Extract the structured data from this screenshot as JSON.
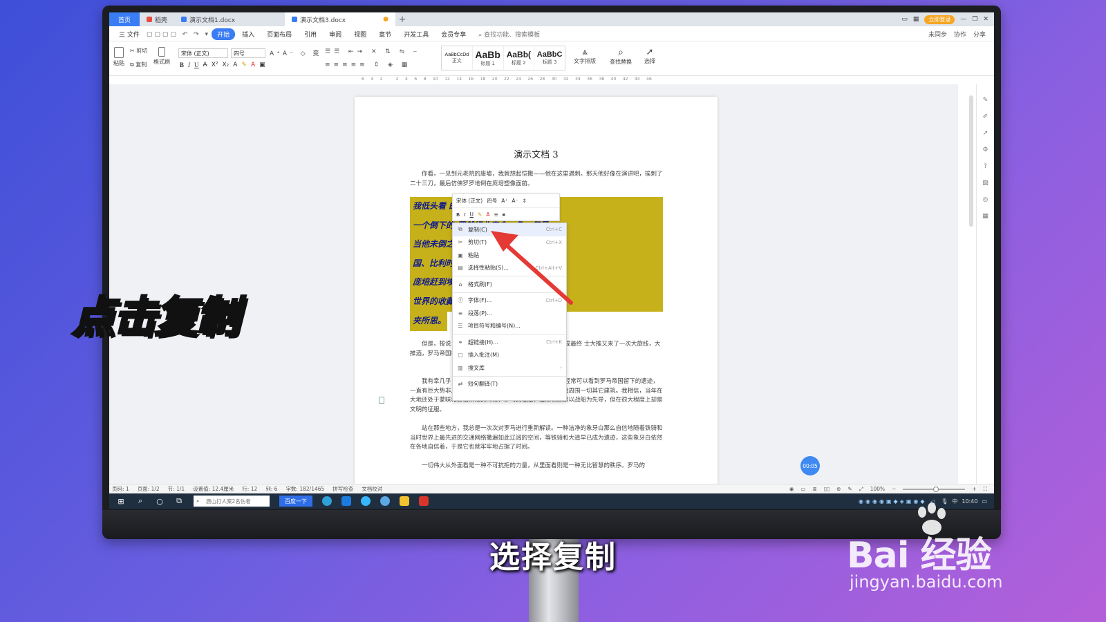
{
  "tabs": {
    "home": "首页",
    "items": [
      {
        "label": "稻壳",
        "color": "#e84c3d"
      },
      {
        "label": "演示文档1.docx",
        "color": "#3a7cf4"
      },
      {
        "label": "演示文档3.docx",
        "color": "#3a7cf4",
        "active": true
      }
    ],
    "add": "+",
    "login": "立即登录"
  },
  "menubar": {
    "file": "三 文件",
    "items": [
      "开始",
      "插入",
      "页面布局",
      "引用",
      "审阅",
      "视图",
      "章节",
      "开发工具",
      "会员专享"
    ],
    "active_index": 0,
    "search": "查找功能、搜索模板",
    "right": [
      "未同步",
      "协作",
      "分享"
    ]
  },
  "ribbon": {
    "paste": "粘贴",
    "cut": "剪切",
    "copy": "复制",
    "format_painter": "格式刷",
    "font_name": "宋体 (正文)",
    "font_size": "四号",
    "styles": [
      {
        "sample": "AaBbCcDd",
        "label": "正文"
      },
      {
        "sample": "AaBb",
        "label": "标题 1"
      },
      {
        "sample": "AaBb(",
        "label": "标题 2"
      },
      {
        "sample": "AaBbC",
        "label": "标题 3"
      }
    ],
    "text_layout": "文字排版",
    "find_replace": "查找替换",
    "select": "选择"
  },
  "ruler_ticks": [
    "6",
    "4",
    "2",
    "",
    "2",
    "4",
    "6",
    "8",
    "10",
    "12",
    "14",
    "16",
    "18",
    "20",
    "22",
    "24",
    "26",
    "28",
    "30",
    "32",
    "34",
    "36",
    "38",
    "40",
    "42",
    "44",
    "46"
  ],
  "document": {
    "title": "演示文档 3",
    "para1": "你看，一见到元老院的废墟，我就想起恺撒——他在这里遇刺。那天他好像在演讲吧，挨刺了二十三刀，最后仿佛罗罗地倒在庞培塑像面前。",
    "highlight_lines": [
      "我低头看                                     的地方。这地方一定很小，",
      "一个倒下的                                   罗然蜷曲房舍一角。但是",
      "当他未倒之                                   发现在意大利、西班牙、法",
      "国、比利时                                   的国南部。他还为追杀政敌",
      "庞培赶到埃                                   文又横扫地中海沿岸。英雄",
      "世界的收藏                                   对于空间的拼酒，简直由",
      "夹所思。"
    ],
    "para2": "但是，按说                                                从。就连恺撒，也不能例外，当然以死亡完成最终                                           士大推又来了一次大旋线，大推酒，罗马帝国横跨欧",
    "para3": "我有幸几乎                                                 ，不管是在欧洲、亚洲还是非洲，在那里，经常可以看到罗马帝国留下的遗迹，一直有巨大势非凡，精雅而又恢宏，甚至直到今天还足以睥睨周围一切其它建筑。我相信，当年在大地还处于蒙昧和野蛮阶段的时候，罗马的征服，虽然也总是以战船为先导，但在很大程度上却是文明的征服。",
    "para4": "站在那些地方，我总是一次次对罗马进行重新解读。一种洁净的象牙白那么自信地随着铁骑和当时世界上最先进的交通网络撒遍如此辽阔的空间，等铁骑和大道早已成为遗迹，这些象牙白依然在各地自信着，于是它也就牢牢地占据了时间。",
    "para5": "一切伟大从外面看是一种不可抗拒的力量，从里面看则是一种无比智慧的秩序。罗马的"
  },
  "mini_toolbar": {
    "font_name": "宋体 (正文)",
    "font_size": "四号"
  },
  "context_menu": {
    "items": [
      {
        "icon": "copy-icon",
        "glyph": "⧉",
        "label": "复制(C)",
        "shortcut": "Ctrl+C",
        "hover": true
      },
      {
        "icon": "scissors-icon",
        "glyph": "✂",
        "label": "剪切(T)",
        "shortcut": "Ctrl+X"
      },
      {
        "icon": "paste-icon",
        "glyph": "▣",
        "label": "粘贴",
        "shortcut": ""
      },
      {
        "icon": "paste-special-icon",
        "glyph": "▤",
        "label": "选择性粘贴(S)...",
        "shortcut": "Ctrl+Alt+V"
      },
      {
        "sep": true
      },
      {
        "icon": "format-painter-icon",
        "glyph": "⌂",
        "label": "格式刷(F)",
        "shortcut": ""
      },
      {
        "sep": true
      },
      {
        "icon": "font-icon",
        "glyph": "Ⓣ",
        "label": "字体(F)...",
        "shortcut": "Ctrl+D"
      },
      {
        "icon": "paragraph-icon",
        "glyph": "≡",
        "label": "段落(P)...",
        "shortcut": ""
      },
      {
        "icon": "list-icon",
        "glyph": "☰",
        "label": "项目符号和编号(N)...",
        "shortcut": ""
      },
      {
        "sep": true
      },
      {
        "icon": "hyperlink-icon",
        "glyph": "⚭",
        "label": "超链接(H)...",
        "shortcut": "Ctrl+K"
      },
      {
        "icon": "comment-icon",
        "glyph": "▢",
        "label": "插入批注(M)",
        "shortcut": ""
      },
      {
        "icon": "library-icon",
        "glyph": "▥",
        "label": "搜文库",
        "shortcut": "›"
      },
      {
        "sep": true
      },
      {
        "icon": "translate-icon",
        "glyph": "⇄",
        "label": "短句翻译(T)",
        "shortcut": ""
      }
    ]
  },
  "timer": "00:05",
  "statusbar": {
    "items": [
      "页码: 1",
      "页面: 1/2",
      "节: 1/1",
      "设置值: 12.4厘米",
      "行: 12",
      "列: 6",
      "字数: 182/1465",
      "拼写检查",
      "文档校对"
    ],
    "zoom": "100%"
  },
  "taskbar": {
    "search_placeholder": "唐山打人案2名伤者",
    "search_button": "百度一下",
    "time": "10:40",
    "ime": "中"
  },
  "captions": {
    "left": "点击复制",
    "bottom": "选择复制"
  },
  "watermark": {
    "main": "Bai  经验",
    "sub": "jingyan.baidu.com"
  }
}
